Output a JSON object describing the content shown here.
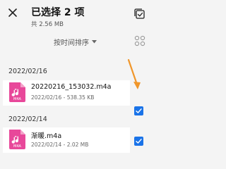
{
  "header": {
    "title": "已选择 2 项",
    "subtitle": "共 2.56 MB"
  },
  "toolbar": {
    "sort_label": "按时间排序"
  },
  "groups": [
    {
      "date": "2022/02/16",
      "files": [
        {
          "icon_label": "M4A",
          "name": "20220216_153032.m4a",
          "meta": "2022/02/16 - 538.35 KB",
          "checked": true
        }
      ]
    },
    {
      "date": "2022/02/14",
      "files": [
        {
          "icon_label": "M4A",
          "name": "渐暖.m4a",
          "meta": "2022/02/14 - 2.02 MB",
          "checked": true
        }
      ]
    }
  ],
  "colors": {
    "accent": "#1a73e8",
    "file_icon": "#e8489a",
    "annotation_arrow": "#f0962a",
    "background": "#f4f4f4"
  },
  "icons": {
    "close": "close-icon",
    "select_all": "select-all-icon",
    "sort_dropdown": "chevron-down-icon",
    "view_toggle": "grid-view-icon",
    "file": "audio-file-icon",
    "check": "check-icon"
  }
}
